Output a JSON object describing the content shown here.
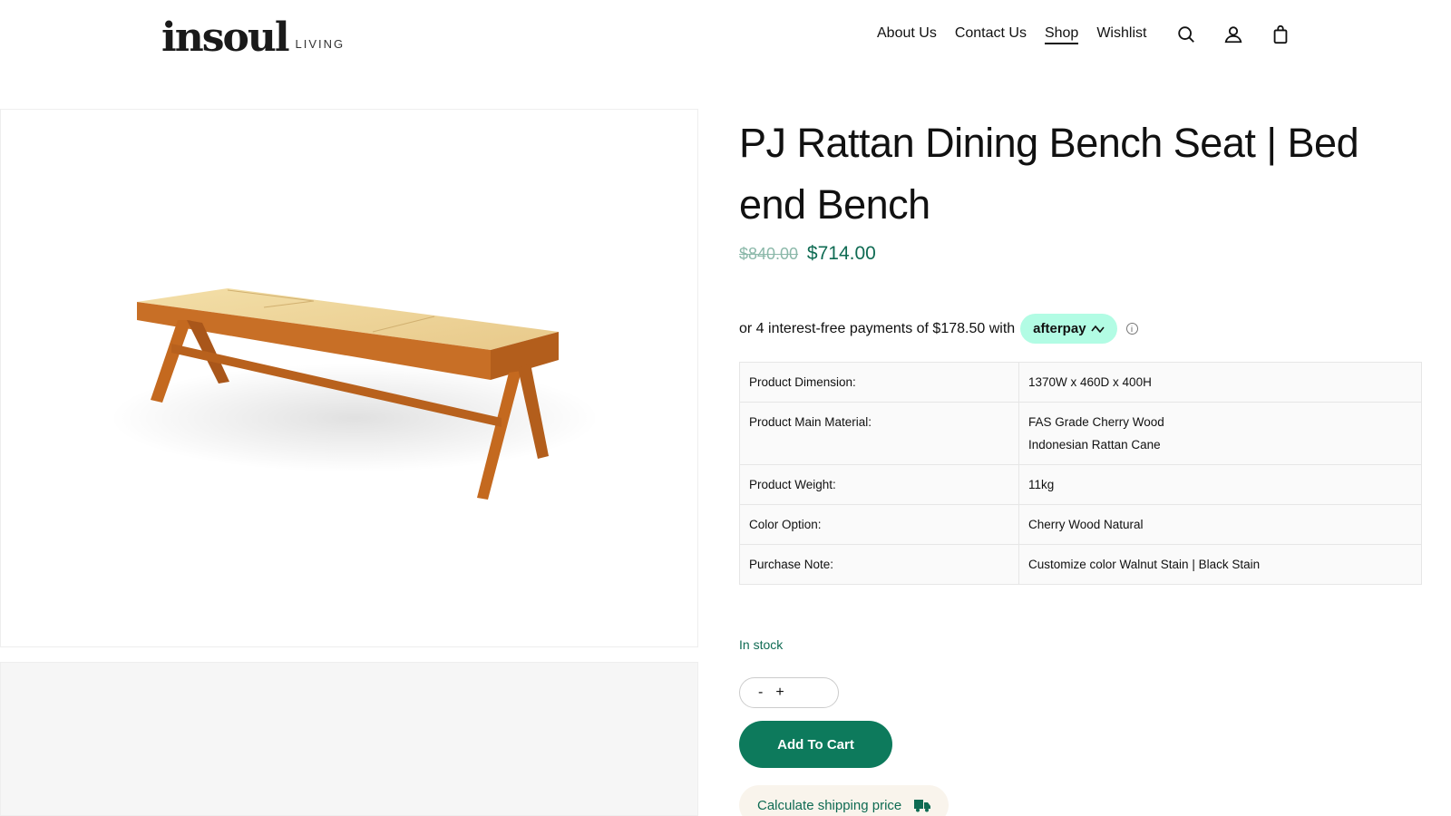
{
  "header": {
    "logo_main": "insoul",
    "logo_sub": "LIVING",
    "nav": {
      "about": "About Us",
      "contact": "Contact Us",
      "shop": "Shop",
      "wishlist": "Wishlist"
    },
    "icons": [
      "search-icon",
      "account-icon",
      "cart-icon"
    ]
  },
  "product": {
    "title": "PJ Rattan Dining Bench Seat | Bed end Bench",
    "price_old": "$840.00",
    "price_new": "$714.00",
    "afterpay_text": "or 4 interest-free payments of $178.50 with",
    "afterpay_brand": "afterpay",
    "specs": [
      {
        "key": "Product Dimension:",
        "values": [
          "1370W x 460D x 400H"
        ]
      },
      {
        "key": "Product Main Material:",
        "values": [
          "FAS Grade Cherry Wood",
          "Indonesian Rattan Cane"
        ]
      },
      {
        "key": "Product Weight:",
        "values": [
          "11kg"
        ]
      },
      {
        "key": "Color Option:",
        "values": [
          "Cherry Wood Natural"
        ]
      },
      {
        "key": "Purchase Note:",
        "values": [
          "Customize color Walnut Stain | Black Stain"
        ]
      }
    ],
    "stock": "In stock",
    "qty_minus": "-",
    "qty_plus": "+",
    "add_to_cart": "Add To Cart",
    "shipping": "Calculate shipping price"
  },
  "colors": {
    "accent": "#0d7a5c",
    "price": "#0f6b53",
    "afterpay": "#b2fce4"
  }
}
